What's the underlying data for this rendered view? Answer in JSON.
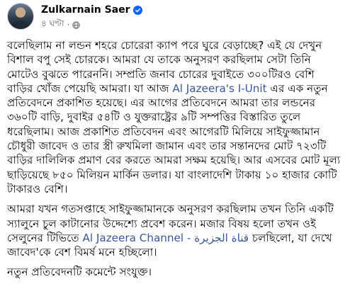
{
  "post": {
    "author": "Zulkarnain Saer",
    "timestamp": "৪ ঘণ্টা",
    "separator": "·",
    "icons": {
      "verified": "verified-badge-icon",
      "audience": "globe-icon"
    },
    "accent_color": "#0866ff",
    "link_color": "#385898",
    "paragraphs": [
      {
        "t1": "বলেছিলাম না লন্ডন শহরে চোরেরা ক্যাপ পরে ঘুরে বেড়াচ্ছে? এই যে দেখুন বিশাল বপু সেই চোরকে। আমরা যে তাকে অনুসরণ করছিলাম সেটা তিনি মোটেও বুঝতে পারেননি। সম্প্রতি জনাব চোরের দুবাইতে ৩০০টিরও বেশি বাড়ির খোঁজ পেয়েছি আমরা। যা আজ ",
        "link": "Al Jazeera's I-Unit",
        "t2": " এর এক নতুন প্রতিবেদনে প্রকাশিত হয়েছে। এর আগের প্রতিবেদনে আমরা তার লন্ডনের ৩৬০টি বাড়ি, দুবাইর ৫৪টি ও যুক্তরাষ্ট্রের ৯টি সম্পত্তির বিস্তারিত তুলে ধরেছিলাম। আজ প্রকাশিত প্রতিবেদন এবং আগেরটি মিলিয়ে সাইফুজ্জামান চৌধুরী জাবেদ ও তার স্ত্রী রুখমিলা জামান এবং তার সন্তানদের মোট ৭২৩টি বাড়ির দালিলিক প্রমাণ বের করতে আমরা সক্ষম হয়েছি। আর এসবের মোট মূল্য ছাড়িয়েছে ৮৫০ মিলিয়ন মার্কিন ডলার। যা বাংলাদেশি টাকায় ১০ হাজার কোটি টাকারও বেশি।"
      },
      {
        "t1": "আমরা যখন গতসপ্তাহে সাইফুজ্জামানকে অনুসরণ করছিলাম তখন তিনি একটি স্যালুনে চুল কাটানোর উদ্দেশ্যে প্রবেশ করেন। মজার বিষয় হলো তখন ওই সেলুনের টিভিতে ",
        "link": "Al Jazeera Channel - قناة الجزيرة",
        "t2": " চলছিলো, যা দেখে জাবেদ'কে বেশ বিমর্ষ মনে হচ্ছিলো।"
      },
      {
        "t1": "নতুন প্রতিবেদনটি কমেন্টে সংযুক্ত।"
      }
    ]
  }
}
